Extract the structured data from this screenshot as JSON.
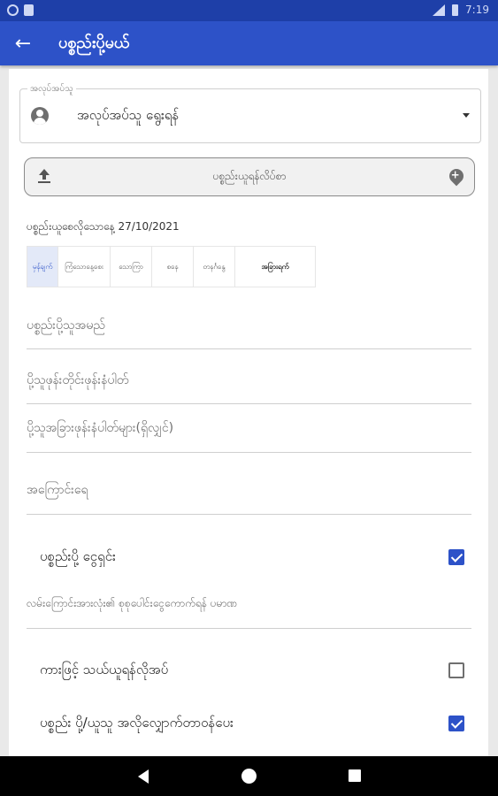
{
  "status_bar": {
    "time": "7:19"
  },
  "app_bar": {
    "back_icon": "arrow-left-icon",
    "title": "ပစ္စည်းပို့မယ်"
  },
  "sender_select": {
    "legend": "အလုပ်အပ်သူ",
    "value": "အလုပ်အပ်သူ ရွေးရန်",
    "icon": "account-circle-icon"
  },
  "upload_button": {
    "label": "ပစ္စည်းယူရန်လိပ်စာ",
    "left_icon": "upload-icon",
    "right_icon": "add-location-icon"
  },
  "date_text": "ပစ္စည်းယူစေလိုသောနေ့ 27/10/2021",
  "tabs": [
    {
      "label": "မှန်ချက်"
    },
    {
      "label": "ကြံသောနေ့စေး"
    },
    {
      "label": "သောကြာ"
    },
    {
      "label": "စနေ"
    },
    {
      "label": "တနင်္ဂနွေ"
    },
    {
      "label": "အခြားရက်"
    }
  ],
  "fields": {
    "receiver_name": "ပစ္စည်းပို့သူအမည်",
    "receiver_phone": "ပို့သူဖုန်းတိုင်းဖုန်းနံပါတ်",
    "other_phones": "ပို့သူအခြားဖုန်းနံပါတ်များ(ရှိလျှင်)",
    "address": "အကြောင်းရေ"
  },
  "checks": {
    "cod": {
      "label": "ပစ္စည်းပို့ ငွေရှင်း",
      "checked": true
    },
    "car_needed": {
      "label": "ကားဖြင့် သယ်ယူရန်လိုအပ်",
      "checked": false
    },
    "notify": {
      "label": "ပစ္စည်း ပို့/ယူသူ အလိုလျှောက်တာဝန်ပေး",
      "checked": true
    }
  },
  "cod_note": "လမ်းကြောင်းအားလုံး၏ စုစုပေါင်းငွေကောက်ရန် ပမာဏ",
  "colors": {
    "primary": "#2d52c8",
    "status_bar": "#1e3fa8"
  }
}
